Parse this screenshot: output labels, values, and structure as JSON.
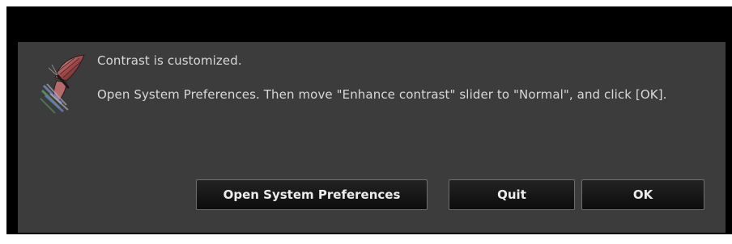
{
  "dialog": {
    "icon": "butterfly-app-icon",
    "title": "Contrast is customized.",
    "message": "Open System Preferences. Then move \"Enhance contrast\" slider to \"Normal\", and click [OK].",
    "buttons": {
      "open_prefs": "Open System Preferences",
      "quit": "Quit",
      "ok": "OK"
    }
  },
  "colors": {
    "frame": "#000000",
    "dialog_background": "#3c3c3c",
    "text": "#d8d8d8",
    "button_text": "#ececec"
  }
}
